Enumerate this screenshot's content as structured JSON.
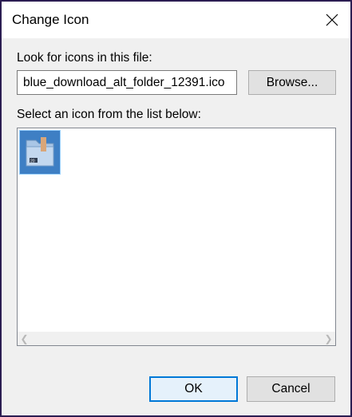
{
  "dialog": {
    "title": "Change Icon",
    "file_label": "Look for icons in this file:",
    "file_value": "blue_download_alt_folder_12391.ico",
    "browse_label": "Browse...",
    "list_label": "Select an icon from the list below:",
    "ok_label": "OK",
    "cancel_label": "Cancel"
  },
  "icons": [
    {
      "name": "blue-folder-download-icon",
      "selected": true
    }
  ],
  "colors": {
    "accent": "#0078d7",
    "selection": "#cce8ff",
    "folder": "#3e7fc4"
  }
}
